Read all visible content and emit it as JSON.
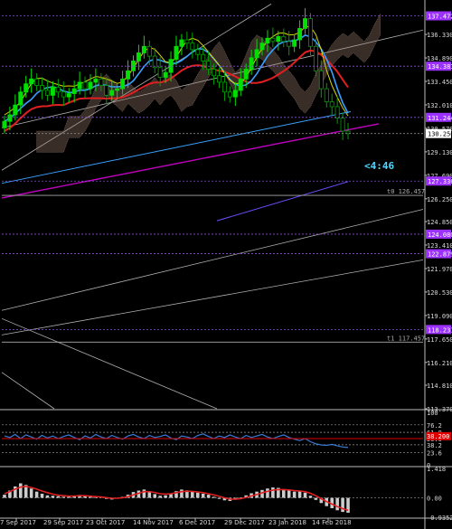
{
  "chart_data": [
    {
      "type": "candlestick",
      "timeframe_countdown": "<4:46",
      "x_tick_labels": [
        "7 Sep 2017",
        "29 Sep 2017",
        "23 Oct 2017",
        "14 Nov 2017",
        "6 Dec 2017",
        "29 Dec 2017",
        "23 Jan 2018",
        "14 Feb 2018"
      ],
      "y_ticks": [
        "136.330",
        "134.890",
        "133.450",
        "132.010",
        "130.570",
        "129.130",
        "127.690",
        "126.250",
        "124.850",
        "123.410",
        "121.970",
        "120.530",
        "119.090",
        "117.650",
        "116.210",
        "114.810",
        "113.370"
      ],
      "ylim": [
        113.37,
        138.0
      ],
      "price_badges": [
        {
          "label": "137.472",
          "value": 137.472,
          "color": "#9b30ff"
        },
        {
          "label": "134.383",
          "value": 134.383,
          "color": "#9b30ff"
        },
        {
          "label": "131.244",
          "value": 131.244,
          "color": "#9b30ff"
        },
        {
          "label": "130.250",
          "value": 130.25,
          "color": "#ffffff"
        },
        {
          "label": "127.336",
          "value": 127.336,
          "color": "#9b30ff"
        },
        {
          "label": "124.080",
          "value": 124.08,
          "color": "#9b30ff"
        },
        {
          "label": "122.879",
          "value": 122.879,
          "color": "#9b30ff"
        },
        {
          "label": "118.231",
          "value": 118.231,
          "color": "#9b30ff"
        }
      ],
      "horizontal_levels": [
        {
          "label": "t0 126.457",
          "value": 126.457
        },
        {
          "label": "t1 117.457",
          "value": 117.457
        }
      ],
      "close_series": [
        131.0,
        131.4,
        132.0,
        132.8,
        133.3,
        133.6,
        133.2,
        132.9,
        132.6,
        133.1,
        132.8,
        132.5,
        132.7,
        133.0,
        133.4,
        133.0,
        133.4,
        133.6,
        133.2,
        132.6,
        132.9,
        133.0,
        133.6,
        134.1,
        134.7,
        135.2,
        135.6,
        135.0,
        134.3,
        133.7,
        134.0,
        134.8,
        135.6,
        136.0,
        135.8,
        135.4,
        135.1,
        134.7,
        134.2,
        133.8,
        133.4,
        132.8,
        132.5,
        132.9,
        133.6,
        134.2,
        134.9,
        135.4,
        135.8,
        136.1,
        135.9,
        136.2,
        135.9,
        135.6,
        136.0,
        136.7,
        137.3,
        135.6,
        134.1,
        133.0,
        132.2,
        131.9,
        131.2,
        130.4,
        130.25
      ]
    },
    {
      "type": "line",
      "indicator": "oscillator",
      "y_tick_labels": [
        "100",
        "76.2",
        "61.8",
        "50.0",
        "38.2",
        "23.6",
        "0"
      ],
      "level_values": [
        100,
        76.2,
        61.8,
        50.0,
        38.2,
        23.6,
        0
      ],
      "ylim": [
        0,
        100
      ],
      "current_value_label": "38.200",
      "values": [
        55,
        52,
        58,
        50,
        57,
        53,
        49,
        56,
        51,
        55,
        50,
        54,
        57,
        52,
        48,
        55,
        51,
        58,
        53,
        50,
        56,
        52,
        49,
        55,
        58,
        53,
        50,
        56,
        52,
        54,
        57,
        51,
        48,
        55,
        53,
        50,
        56,
        59,
        54,
        50,
        55,
        52,
        57,
        53,
        50,
        56,
        52,
        55,
        58,
        53,
        50,
        54,
        57,
        52,
        49,
        46,
        50,
        44,
        40,
        38,
        37,
        39,
        36,
        34,
        33
      ]
    },
    {
      "type": "bar",
      "indicator": "histogram",
      "y_tick_labels": [
        "1.418",
        "0.00",
        "-0.9352"
      ],
      "ylim": [
        -0.9352,
        1.418
      ],
      "values": [
        0.15,
        0.35,
        0.55,
        0.7,
        0.62,
        0.45,
        0.3,
        0.2,
        0.12,
        0.1,
        0.08,
        0.05,
        0.06,
        0.1,
        0.14,
        0.1,
        0.06,
        0.04,
        0.02,
        -0.05,
        -0.08,
        -0.02,
        0.05,
        0.15,
        0.28,
        0.35,
        0.4,
        0.3,
        0.18,
        0.1,
        0.12,
        0.22,
        0.32,
        0.4,
        0.36,
        0.3,
        0.25,
        0.2,
        0.15,
        0.05,
        -0.05,
        -0.12,
        -0.15,
        -0.08,
        0.02,
        0.12,
        0.22,
        0.3,
        0.38,
        0.45,
        0.5,
        0.48,
        0.42,
        0.35,
        0.3,
        0.32,
        0.25,
        0.1,
        -0.1,
        -0.25,
        -0.4,
        -0.5,
        -0.6,
        -0.68,
        -0.72
      ],
      "signal": [
        0.2,
        0.3,
        0.42,
        0.52,
        0.55,
        0.5,
        0.42,
        0.33,
        0.25,
        0.18,
        0.13,
        0.1,
        0.08,
        0.09,
        0.1,
        0.1,
        0.08,
        0.06,
        0.04,
        0.01,
        -0.02,
        -0.02,
        0.0,
        0.06,
        0.14,
        0.22,
        0.3,
        0.3,
        0.26,
        0.2,
        0.18,
        0.2,
        0.25,
        0.3,
        0.32,
        0.31,
        0.28,
        0.25,
        0.2,
        0.14,
        0.07,
        0.0,
        -0.06,
        -0.07,
        -0.04,
        0.02,
        0.09,
        0.16,
        0.24,
        0.31,
        0.37,
        0.4,
        0.4,
        0.38,
        0.35,
        0.33,
        0.3,
        0.22,
        0.1,
        -0.04,
        -0.18,
        -0.3,
        -0.42,
        -0.52,
        -0.6
      ]
    }
  ],
  "colors": {
    "background": "#000000",
    "bull_candle": "#00e000",
    "bear_candle": "#00a000",
    "badge_purple": "#9b30ff",
    "badge_red": "#e00000",
    "grid_dotted": "#777777",
    "ma_red": "#e02020",
    "ma_blue": "#3aa0ff",
    "ma_yellow": "#d8d800",
    "ma_magenta": "#c000c0",
    "ichimoku_cloud": "#a08070",
    "osc_line": "#3a7bd5",
    "hist_bars": "#cccccc",
    "signal_line": "#e02020"
  }
}
